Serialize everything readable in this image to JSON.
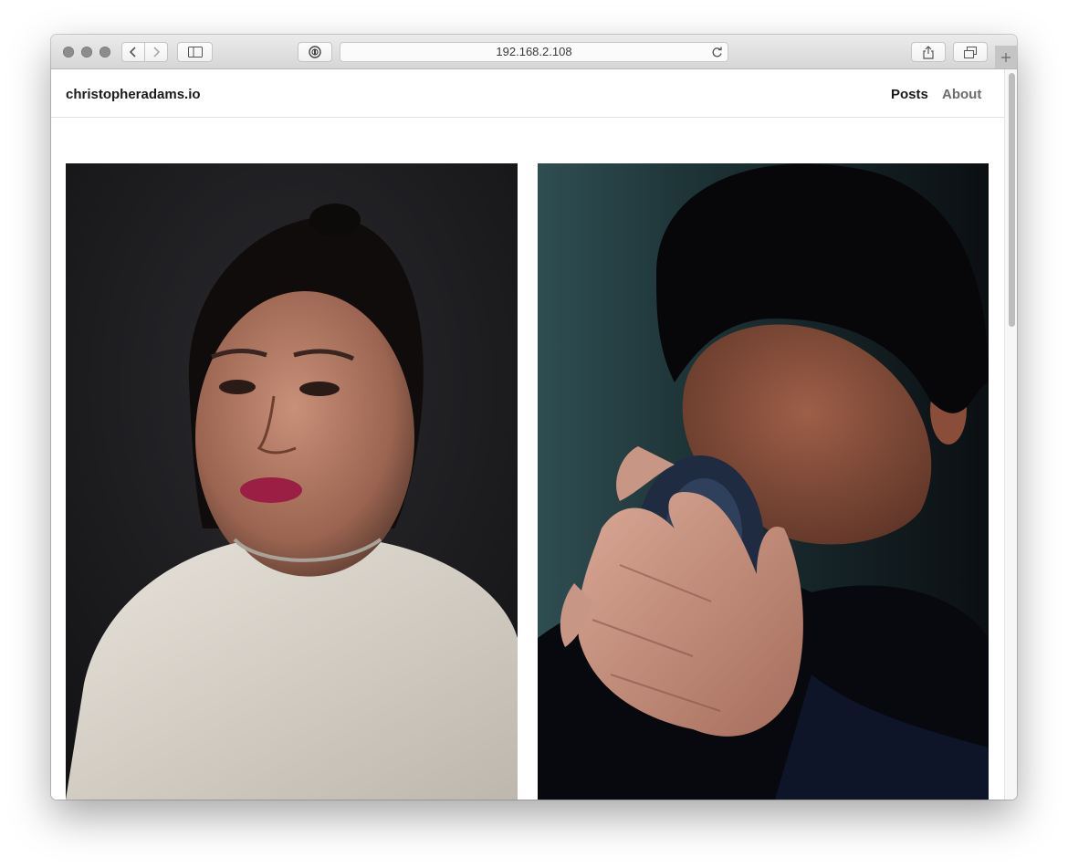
{
  "browser": {
    "url": "192.168.2.108",
    "icons": [
      "back-icon",
      "forward-icon",
      "sidebar-icon",
      "password-icon",
      "reload-icon",
      "share-icon",
      "tabs-icon",
      "new-tab-icon"
    ]
  },
  "site": {
    "brand": "christopheradams.io",
    "nav": {
      "posts": "Posts",
      "about": "About"
    }
  },
  "colors": {
    "nav_active": "#1b1b1b",
    "nav_inactive": "#6b6b6b",
    "photo_dark": "#141416"
  },
  "gallery": {
    "photos": [
      "portrait-woman-white-tshirt",
      "portrait-man-drinking-from-cup"
    ]
  }
}
